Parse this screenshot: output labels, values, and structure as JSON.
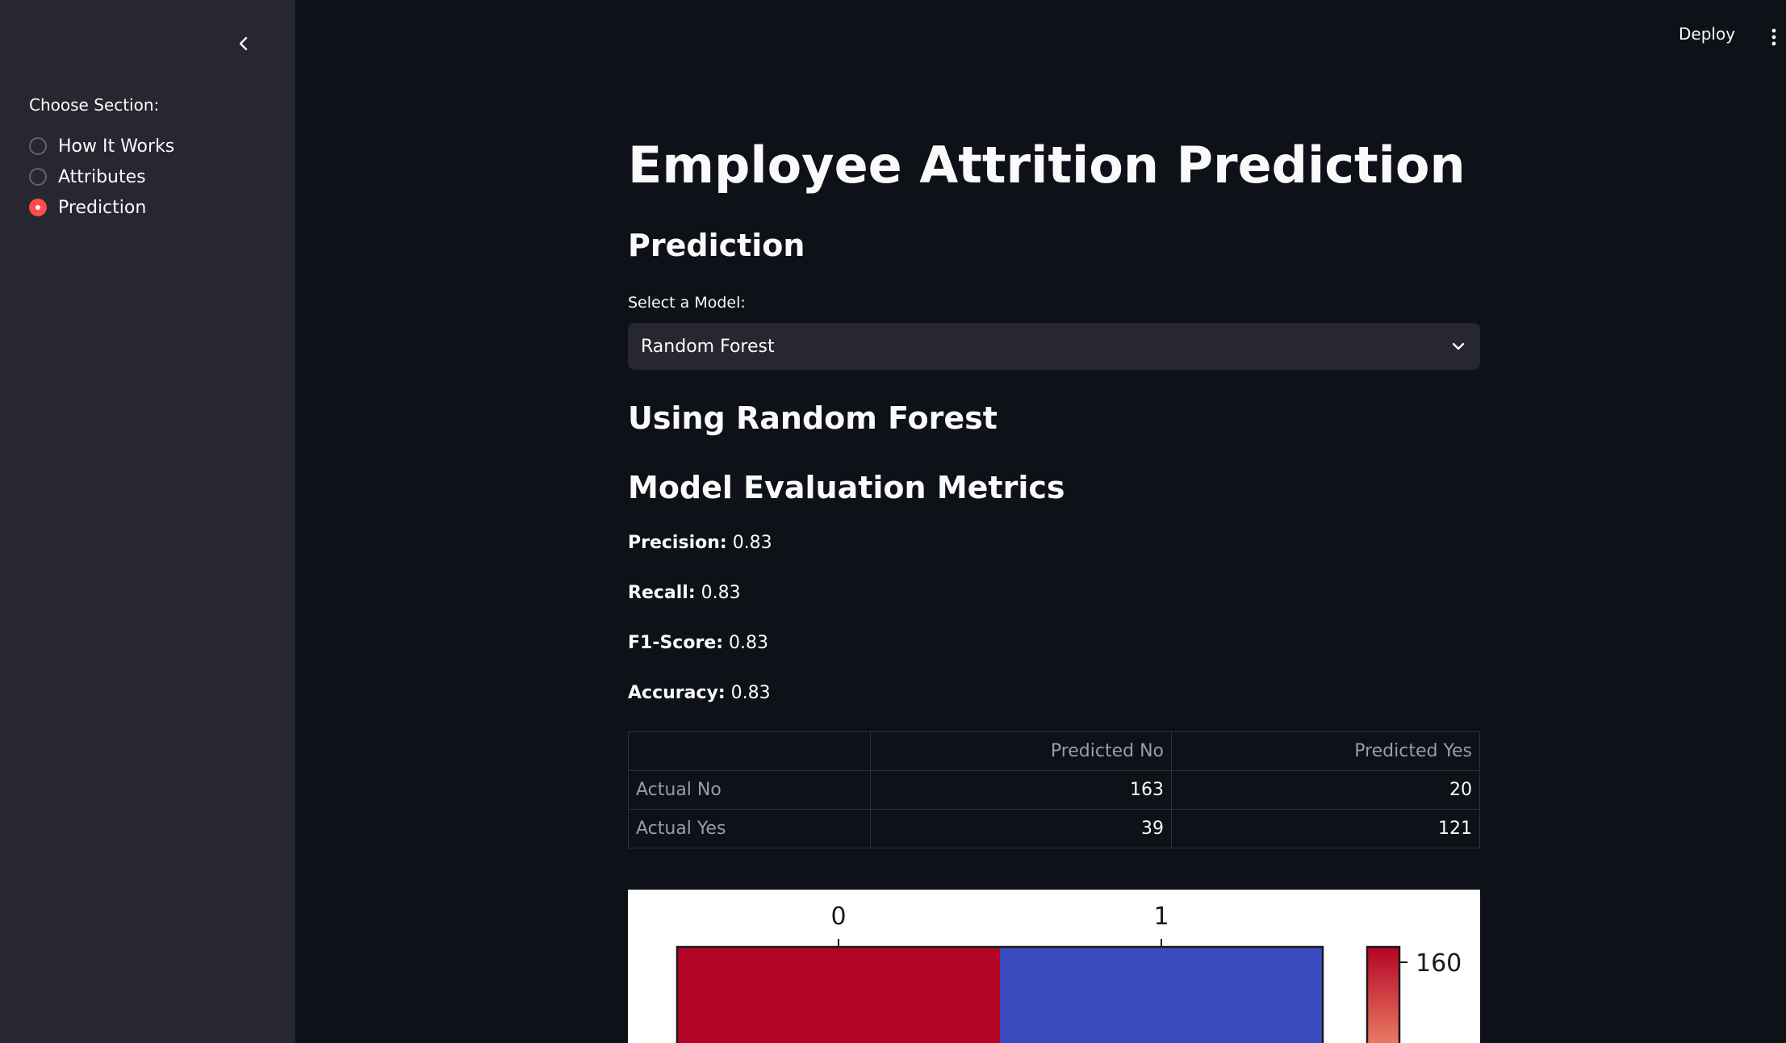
{
  "sidebar": {
    "section_label": "Choose Section:",
    "options": [
      {
        "label": "How It Works",
        "selected": false
      },
      {
        "label": "Attributes",
        "selected": false
      },
      {
        "label": "Prediction",
        "selected": true
      }
    ],
    "accent_color": "#ff4b4b"
  },
  "header": {
    "deploy_label": "Deploy"
  },
  "main": {
    "title": "Employee Attrition Prediction",
    "section_heading": "Prediction",
    "select_label": "Select a Model:",
    "selected_model": "Random Forest",
    "using_heading": "Using Random Forest",
    "metrics_heading": "Model Evaluation Metrics",
    "metrics": {
      "precision_label": "Precision:",
      "precision_value": "0.83",
      "recall_label": "Recall:",
      "recall_value": "0.83",
      "f1_label": "F1-Score:",
      "f1_value": "0.83",
      "accuracy_label": "Accuracy:",
      "accuracy_value": "0.83"
    },
    "table": {
      "columns": [
        "",
        "Predicted No",
        "Predicted Yes"
      ],
      "rows": [
        {
          "label": "Actual No",
          "values": [
            "163",
            "20"
          ]
        },
        {
          "label": "Actual Yes",
          "values": [
            "39",
            "121"
          ]
        }
      ]
    }
  },
  "chart_data": {
    "type": "heatmap",
    "x_tick_labels": [
      "0",
      "1"
    ],
    "colorbar_tick_labels": [
      "160"
    ],
    "colormap": "coolwarm",
    "colors": {
      "high": "#b40426",
      "low": "#3b4cc0"
    }
  }
}
